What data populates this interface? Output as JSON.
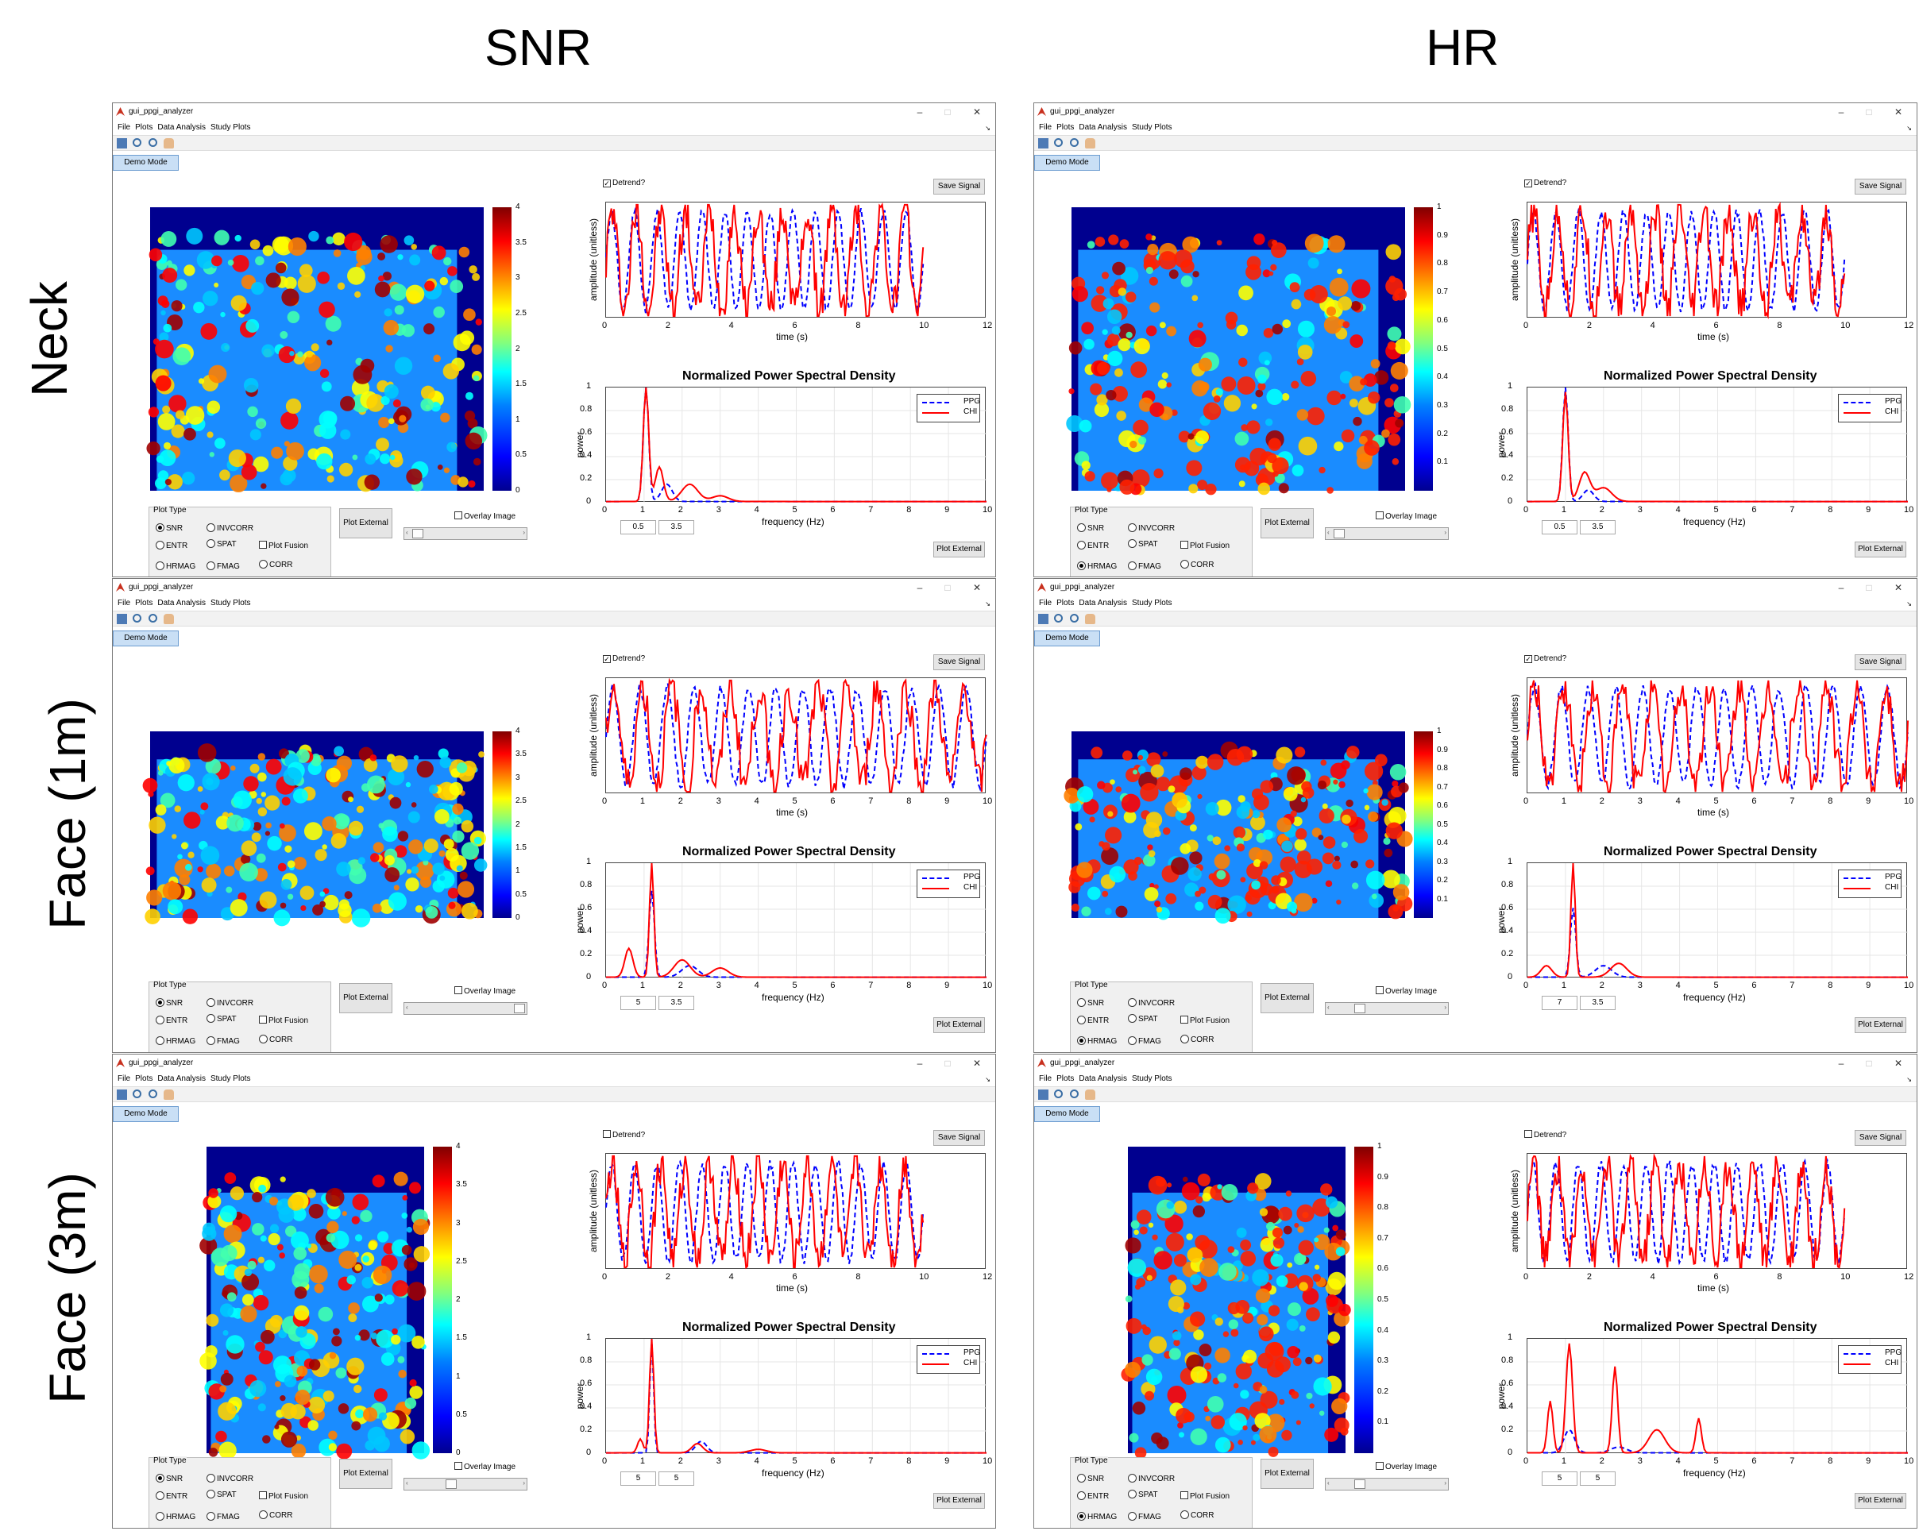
{
  "columns": {
    "left": "SNR",
    "right": "HR"
  },
  "rows": {
    "neck": "Neck",
    "face1": "Face (1m)",
    "face3": "Face (3m)"
  },
  "window": {
    "title": "gui_ppgi_analyzer",
    "menu": [
      "File",
      "Plots",
      "Data Analysis",
      "Study Plots"
    ],
    "demo_mode": "Demo Mode",
    "detrend_label": "Detrend?",
    "save_signal": "Save Signal",
    "plot_external": "Plot External",
    "overlay_image": "Overlay Image",
    "plot_type_label": "Plot Type",
    "radio": {
      "snr": "SNR",
      "invcorr": "INVCORR",
      "entr": "ENTR",
      "spat": "SPAT",
      "hrmag": "HRMAG",
      "fmag": "FMAG",
      "corr": "CORR"
    },
    "plot_fusion": "Plot Fusion",
    "time_xlabel": "time (s)",
    "amp_ylabel": "amplitude (unitless)",
    "psd_title": "Normalized Power Spectral Density",
    "psd_xlabel": "frequency (Hz)",
    "psd_ylabel": "power",
    "legend": [
      "PPG",
      "CHI"
    ],
    "time_ticks_12": [
      "0",
      "2",
      "4",
      "6",
      "8",
      "10",
      "12"
    ],
    "time_ticks_10": [
      "0",
      "1",
      "2",
      "3",
      "4",
      "5",
      "6",
      "7",
      "8",
      "9",
      "10"
    ],
    "freq_ticks": [
      "0",
      "1",
      "2",
      "3",
      "4",
      "5",
      "6",
      "7",
      "8",
      "9",
      "10"
    ],
    "power_ticks": [
      "0",
      "0.2",
      "0.4",
      "0.6",
      "0.8",
      "1"
    ],
    "snr_cbar": [
      "4",
      "3.5",
      "3",
      "2.5",
      "2",
      "1.5",
      "1",
      "0.5",
      "0"
    ],
    "hr_cbar": [
      "1",
      "0.9",
      "0.8",
      "0.7",
      "0.6",
      "0.5",
      "0.4",
      "0.3",
      "0.2",
      "0.1"
    ],
    "colors": {
      "ppg": "#0000ff",
      "chi": "#ff0000",
      "demo_bg": "#c9dff5"
    },
    "icons": [
      "export-icon",
      "zoom-in-icon",
      "zoom-out-icon",
      "pan-hand-icon"
    ]
  },
  "windows": [
    {
      "id": "snr-neck",
      "column": "SNR",
      "row": "Neck",
      "detrend": true,
      "selected": "snr",
      "time_axis": "12",
      "freq_low": "0.5",
      "freq_high": "3.5",
      "map": "snr"
    },
    {
      "id": "hr-neck",
      "column": "HR",
      "row": "Neck",
      "detrend": true,
      "selected": "hrmag",
      "time_axis": "12",
      "freq_low": "0.5",
      "freq_high": "3.5",
      "map": "hr"
    },
    {
      "id": "snr-face1",
      "column": "SNR",
      "row": "Face (1m)",
      "detrend": true,
      "selected": "snr",
      "time_axis": "10",
      "freq_low": "5",
      "freq_high": "3.5",
      "map": "snr"
    },
    {
      "id": "hr-face1",
      "column": "HR",
      "row": "Face (1m)",
      "detrend": true,
      "selected": "hrmag",
      "time_axis": "10",
      "freq_low": "7",
      "freq_high": "3.5",
      "map": "hr"
    },
    {
      "id": "snr-face3",
      "column": "SNR",
      "row": "Face (3m)",
      "detrend": false,
      "selected": "snr",
      "time_axis": "12",
      "freq_low": "5",
      "freq_high": "5",
      "map": "snr"
    },
    {
      "id": "hr-face3",
      "column": "HR",
      "row": "Face (3m)",
      "detrend": false,
      "selected": "hrmag",
      "time_axis": "12",
      "freq_low": "5",
      "freq_high": "5",
      "map": "hr"
    }
  ]
}
